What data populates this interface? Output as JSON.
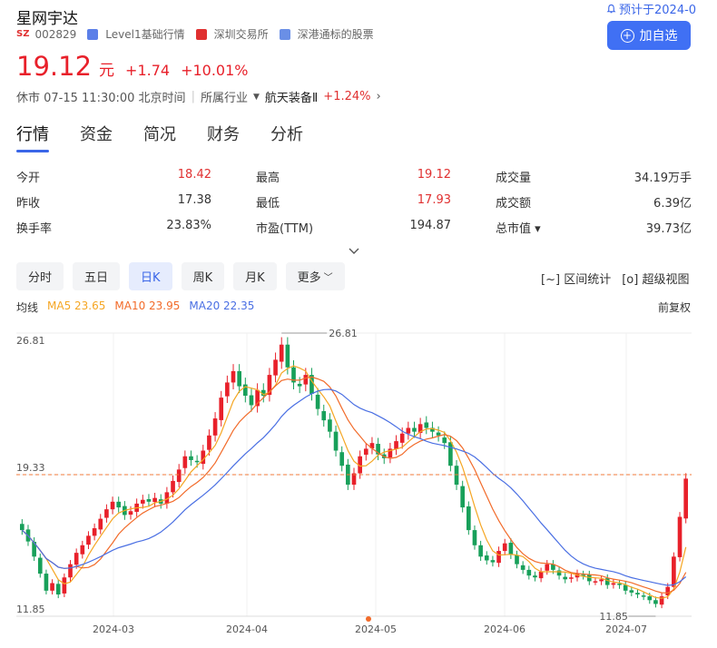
{
  "header": {
    "stock_name": "星网宇达",
    "market": "SZ",
    "code": "002829",
    "level_tag": "Level1基础行情",
    "exchange": "深圳交易所",
    "connect": "深港通标的股票",
    "forecast": "预计于2024-0",
    "add_button": "加自选"
  },
  "quote": {
    "price": "19.12",
    "unit": "元",
    "change": "+1.74",
    "change_pct": "+10.01%",
    "status": "休市 07-15 11:30:00 北京时间",
    "industry_label": "所属行业",
    "industry_name": "航天装备Ⅱ",
    "industry_change": "+1.24%"
  },
  "tabs": [
    "行情",
    "资金",
    "简况",
    "财务",
    "分析"
  ],
  "stats": [
    {
      "label": "今开",
      "value": "18.42",
      "color": "red"
    },
    {
      "label": "最高",
      "value": "19.12",
      "color": "red"
    },
    {
      "label": "成交量",
      "value": "34.19万手",
      "color": ""
    },
    {
      "label": "昨收",
      "value": "17.38",
      "color": ""
    },
    {
      "label": "最低",
      "value": "17.93",
      "color": "red"
    },
    {
      "label": "成交额",
      "value": "6.39亿",
      "color": ""
    },
    {
      "label": "换手率",
      "value": "23.83%",
      "color": ""
    },
    {
      "label": "市盈(TTM)",
      "value": "194.87",
      "color": ""
    },
    {
      "label": "总市值 ▾",
      "value": "39.73亿",
      "color": ""
    }
  ],
  "periods": [
    "分时",
    "五日",
    "日K",
    "周K",
    "月K",
    "更多"
  ],
  "tools": {
    "interval": "区间统计",
    "super": "超级视图"
  },
  "ma": {
    "label": "均线",
    "ma5": "MA5 23.65",
    "ma10": "MA10 23.95",
    "ma20": "MA20 22.35",
    "fuquan": "前复权",
    "colors": {
      "ma5": "#f5a623",
      "ma10": "#f26b2a",
      "ma20": "#4a6fe3",
      "up": "#e8202a",
      "down": "#18a05a"
    }
  },
  "chart_data": {
    "type": "candlestick",
    "y_axis_labels": [
      "26.81",
      "19.33",
      "11.85"
    ],
    "x_axis_labels": [
      "2024-03",
      "2024-04",
      "2024-05",
      "2024-06",
      "2024-07"
    ],
    "max_label": "26.81",
    "min_label": "11.85",
    "ylim": [
      11.85,
      26.81
    ],
    "last_close": 19.33,
    "closes": [
      16.4,
      15.8,
      15.0,
      14.1,
      13.2,
      13.6,
      13.0,
      13.9,
      14.6,
      15.2,
      15.6,
      16.1,
      16.5,
      17.0,
      17.5,
      17.9,
      17.6,
      17.2,
      17.4,
      17.8,
      18.0,
      17.9,
      18.1,
      17.8,
      18.4,
      19.0,
      19.6,
      20.3,
      20.1,
      20.0,
      20.6,
      21.4,
      22.3,
      23.4,
      24.2,
      24.8,
      24.0,
      23.5,
      23.0,
      23.8,
      23.5,
      24.6,
      25.4,
      26.2,
      25.0,
      24.2,
      24.0,
      24.6,
      23.6,
      22.8,
      22.2,
      21.6,
      20.6,
      19.8,
      18.8,
      19.4,
      20.3,
      20.7,
      21.0,
      20.4,
      20.2,
      20.7,
      21.1,
      21.5,
      21.8,
      21.6,
      22.0,
      21.8,
      21.6,
      21.4,
      21.0,
      19.8,
      18.8,
      17.6,
      16.4,
      15.6,
      15.0,
      14.8,
      14.7,
      15.3,
      15.7,
      15.1,
      14.6,
      14.3,
      14.0,
      13.9,
      14.2,
      14.6,
      14.3,
      14.0,
      13.8,
      13.9,
      14.1,
      14.0,
      13.7,
      13.7,
      13.8,
      13.5,
      13.6,
      13.5,
      13.2,
      13.1,
      13.0,
      12.9,
      12.7,
      12.5,
      12.9,
      13.4,
      15.0,
      17.1,
      19.12
    ]
  }
}
